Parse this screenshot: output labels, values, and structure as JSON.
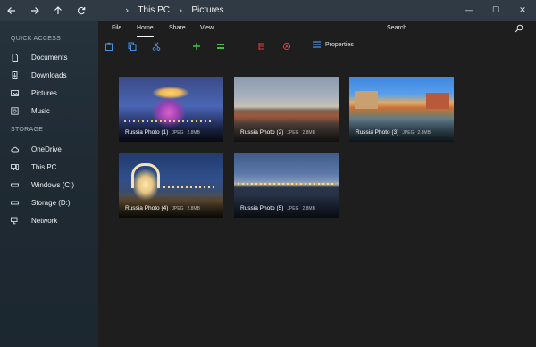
{
  "window": {
    "breadcrumb": [
      "This PC",
      "Pictures"
    ],
    "controls": {
      "minimize": "—",
      "maximize": "☐",
      "close": "✕"
    }
  },
  "nav_icons": [
    "back-arrow-icon",
    "forward-arrow-icon",
    "up-arrow-icon",
    "refresh-icon"
  ],
  "sidebar": {
    "quick_access_heading": "QUICK ACCESS",
    "quick_access": [
      {
        "label": "Documents",
        "icon": "document-icon"
      },
      {
        "label": "Downloads",
        "icon": "download-icon"
      },
      {
        "label": "Pictures",
        "icon": "picture-icon"
      },
      {
        "label": "Music",
        "icon": "music-icon"
      }
    ],
    "storage_heading": "STORAGE",
    "storage": [
      {
        "label": "OneDrive",
        "icon": "cloud-icon"
      },
      {
        "label": "This PC",
        "icon": "computer-icon"
      },
      {
        "label": "Windows (C:)",
        "icon": "drive-icon"
      },
      {
        "label": "Storage (D:)",
        "icon": "drive-icon"
      },
      {
        "label": "Network",
        "icon": "network-icon"
      }
    ]
  },
  "menu": {
    "items": [
      "File",
      "Home",
      "Share",
      "View"
    ],
    "active": "Home",
    "search_label": "Search"
  },
  "toolbar": {
    "tools": [
      {
        "icon": "paste-icon",
        "color": "#4a90e2"
      },
      {
        "icon": "copy-icon",
        "color": "#4a90e2"
      },
      {
        "icon": "cut-icon",
        "color": "#4a90e2"
      },
      {
        "icon": "new-icon",
        "color": "#3fc33f"
      },
      {
        "icon": "select-icon",
        "color": "#3fc33f"
      },
      {
        "icon": "rename-icon",
        "color": "#e23b3b"
      },
      {
        "icon": "delete-icon",
        "color": "#e23b3b"
      }
    ],
    "properties_label": "Properties"
  },
  "files": [
    {
      "name": "Russia Photo (1)",
      "type": "JPEG",
      "size": "2.8MB"
    },
    {
      "name": "Russia Photo (2)",
      "type": "JPEG",
      "size": "2.8MB"
    },
    {
      "name": "Russia Photo (3)",
      "type": "JPEG",
      "size": "2.8MB"
    },
    {
      "name": "Russia Photo (4)",
      "type": "JPEG",
      "size": "2.8MB"
    },
    {
      "name": "Russia Photo (5)",
      "type": "JPEG",
      "size": "2.8MB"
    }
  ],
  "colors": {
    "titlebar": "#2f3a44",
    "sidebar": "#222d36",
    "main_bg": "#1e1e1e",
    "accent_blue": "#4a90e2",
    "accent_green": "#3fc33f",
    "accent_red": "#e23b3b"
  }
}
